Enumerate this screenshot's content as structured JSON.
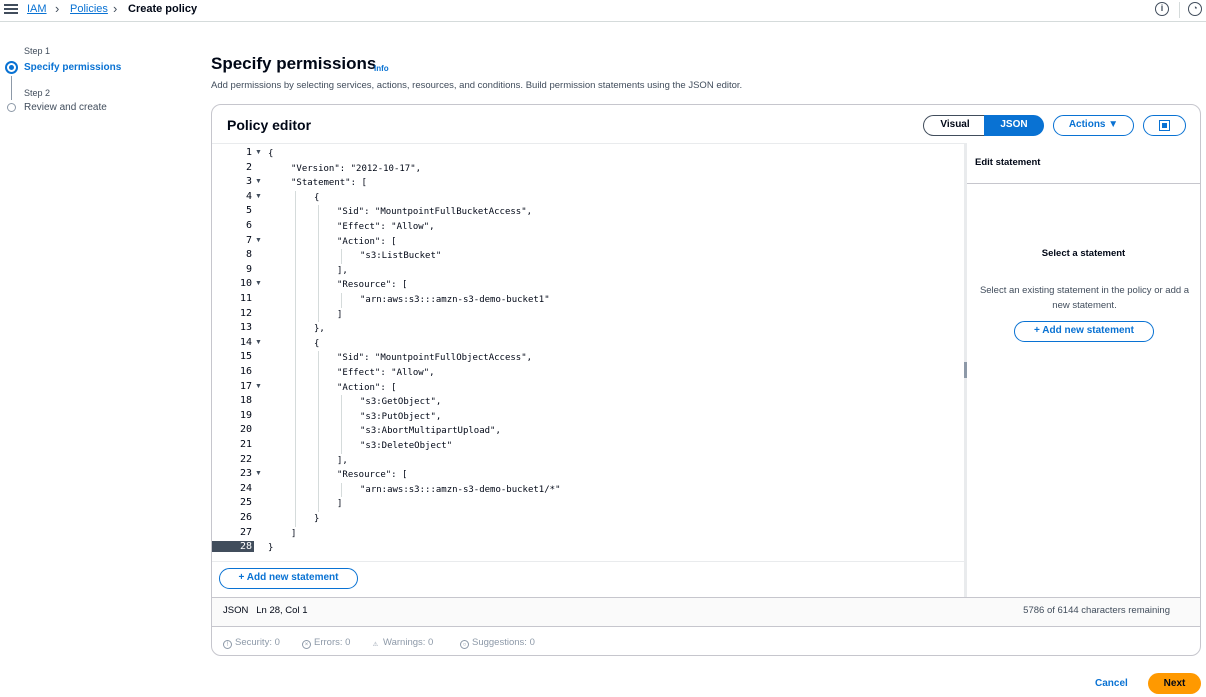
{
  "breadcrumb": {
    "iam": "IAM",
    "policies": "Policies",
    "current": "Create policy"
  },
  "steps": [
    {
      "label": "Step 1",
      "title": "Specify permissions"
    },
    {
      "label": "Step 2",
      "title": "Review and create"
    }
  ],
  "header": {
    "title": "Specify permissions",
    "info": "Info",
    "description": "Add permissions by selecting services, actions, resources, and conditions. Build permission statements using the JSON editor."
  },
  "editor": {
    "title": "Policy editor",
    "mode_visual": "Visual",
    "mode_json": "JSON",
    "actions_label": "Actions ▼",
    "lines": [
      {
        "n": "1",
        "fold": true,
        "indent": 0,
        "text": "{"
      },
      {
        "n": "2",
        "fold": false,
        "indent": 1,
        "text": "\"Version\": \"2012-10-17\","
      },
      {
        "n": "3",
        "fold": true,
        "indent": 1,
        "text": "\"Statement\": ["
      },
      {
        "n": "4",
        "fold": true,
        "indent": 2,
        "text": "{"
      },
      {
        "n": "5",
        "fold": false,
        "indent": 3,
        "text": "\"Sid\": \"MountpointFullBucketAccess\","
      },
      {
        "n": "6",
        "fold": false,
        "indent": 3,
        "text": "\"Effect\": \"Allow\","
      },
      {
        "n": "7",
        "fold": true,
        "indent": 3,
        "text": "\"Action\": ["
      },
      {
        "n": "8",
        "fold": false,
        "indent": 4,
        "text": "\"s3:ListBucket\""
      },
      {
        "n": "9",
        "fold": false,
        "indent": 3,
        "text": "],"
      },
      {
        "n": "10",
        "fold": true,
        "indent": 3,
        "text": "\"Resource\": ["
      },
      {
        "n": "11",
        "fold": false,
        "indent": 4,
        "text": "\"arn:aws:s3:::amzn-s3-demo-bucket1\""
      },
      {
        "n": "12",
        "fold": false,
        "indent": 3,
        "text": "]"
      },
      {
        "n": "13",
        "fold": false,
        "indent": 2,
        "text": "},"
      },
      {
        "n": "14",
        "fold": true,
        "indent": 2,
        "text": "{"
      },
      {
        "n": "15",
        "fold": false,
        "indent": 3,
        "text": "\"Sid\": \"MountpointFullObjectAccess\","
      },
      {
        "n": "16",
        "fold": false,
        "indent": 3,
        "text": "\"Effect\": \"Allow\","
      },
      {
        "n": "17",
        "fold": true,
        "indent": 3,
        "text": "\"Action\": ["
      },
      {
        "n": "18",
        "fold": false,
        "indent": 4,
        "text": "\"s3:GetObject\","
      },
      {
        "n": "19",
        "fold": false,
        "indent": 4,
        "text": "\"s3:PutObject\","
      },
      {
        "n": "20",
        "fold": false,
        "indent": 4,
        "text": "\"s3:AbortMultipartUpload\","
      },
      {
        "n": "21",
        "fold": false,
        "indent": 4,
        "text": "\"s3:DeleteObject\""
      },
      {
        "n": "22",
        "fold": false,
        "indent": 3,
        "text": "],"
      },
      {
        "n": "23",
        "fold": true,
        "indent": 3,
        "text": "\"Resource\": ["
      },
      {
        "n": "24",
        "fold": false,
        "indent": 4,
        "text": "\"arn:aws:s3:::amzn-s3-demo-bucket1/*\""
      },
      {
        "n": "25",
        "fold": false,
        "indent": 3,
        "text": "]"
      },
      {
        "n": "26",
        "fold": false,
        "indent": 2,
        "text": "}"
      },
      {
        "n": "27",
        "fold": false,
        "indent": 1,
        "text": "]"
      },
      {
        "n": "28",
        "fold": false,
        "indent": 0,
        "text": "}",
        "current": true
      }
    ],
    "add_statement": "Add new statement",
    "status_left": "JSON   Ln 28, Col 1",
    "status_right": "5786 of 6144 characters remaining"
  },
  "side_panel": {
    "title": "Edit statement",
    "subtitle": "Select a statement",
    "description": "Select an existing statement in the policy or add a new statement.",
    "add_label": "Add new statement"
  },
  "validation": {
    "security": "Security: 0",
    "errors": "Errors: 0",
    "warnings": "Warnings: 0",
    "suggestions": "Suggestions: 0"
  },
  "footer": {
    "cancel": "Cancel",
    "next": "Next"
  },
  "colors": {
    "accent": "#0972d3",
    "primary_button": "#ff9900",
    "text": "#000716"
  }
}
